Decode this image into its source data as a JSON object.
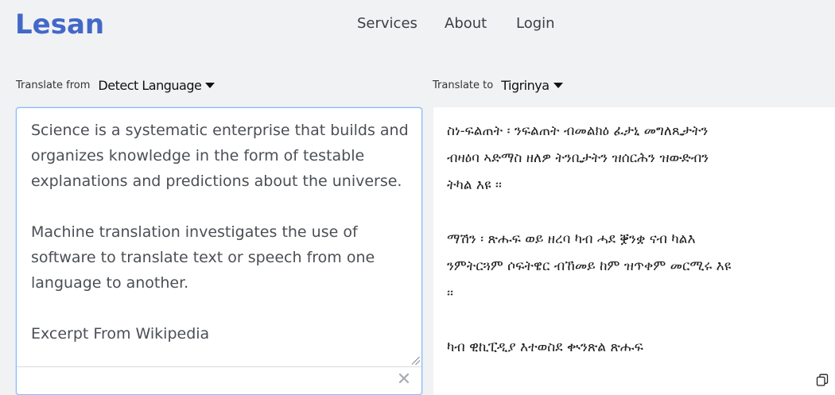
{
  "brand": {
    "logo": "Lesan",
    "accent_color": "#4368c9"
  },
  "nav": {
    "services": "Services",
    "about": "About",
    "login": "Login"
  },
  "source": {
    "label": "Translate from",
    "language": "Detect Language",
    "text": "Science is a systematic enterprise that builds and\norganizes knowledge in the form of testable\nexplanations and predictions about the universe.\n\nMachine translation investigates the use of\nsoftware to translate text or speech from one\nlanguage to another.\n\nExcerpt From Wikipedia",
    "clear_icon": "close-icon"
  },
  "target": {
    "label": "Translate to",
    "language": "Tigrinya",
    "text": "ስነ-ፍልጠት ፡ ንፍልጠት ብመልክዕ ፈታኒ መግለጺታትን\nብዛዕባ ኣድማስ ዘለዎ ትንቢታትን ዝሰርሕን ዝውድብን\nትካል እዩ ፡፡\n\nማሽን ፡ ጽሑፍ ወይ ዘረባ ካብ ሓደ ቛንቋ ናብ ካልእ\nንምትርጓም ሶፍትዌር ብኸመይ ከም ዝጥቀም መርሚሩ እዩ\n፡፡\n\nካብ ዊኪፒዲያ እተወስደ ቊንጽል ጽሑፍ",
    "copy_icon": "copy-icon"
  }
}
